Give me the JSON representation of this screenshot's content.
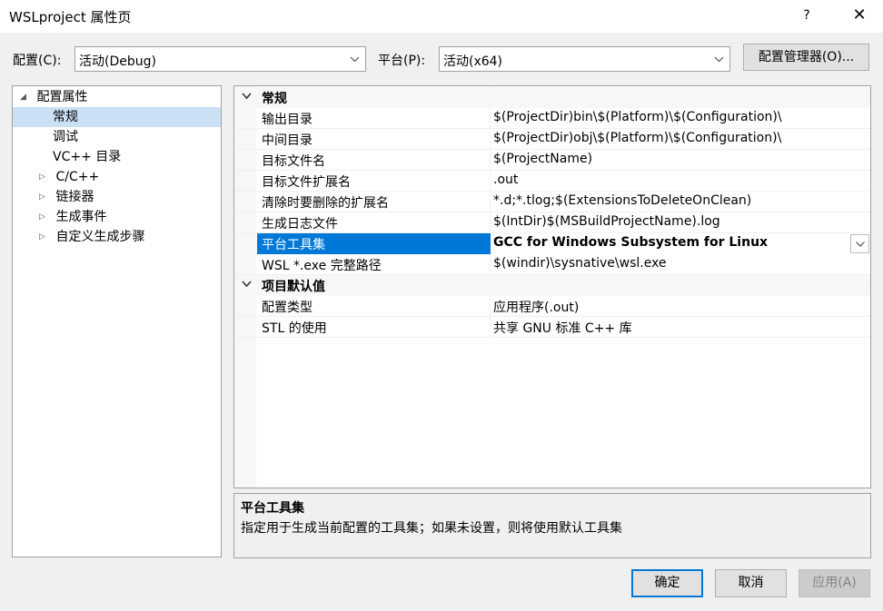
{
  "window": {
    "title": "WSLproject 属性页",
    "help_label": "?",
    "close_label": "✕"
  },
  "toolbar": {
    "config_label": "配置(C):",
    "config_value": "活动(Debug)",
    "platform_label": "平台(P):",
    "platform_value": "活动(x64)",
    "config_manager_label": "配置管理器(O)..."
  },
  "tree": {
    "items": [
      {
        "label": "配置属性",
        "expander": "◢"
      },
      {
        "label": "常规",
        "selected": true
      },
      {
        "label": "调试"
      },
      {
        "label": "VC++ 目录"
      },
      {
        "label": "C/C++",
        "expander": "▷"
      },
      {
        "label": "链接器",
        "expander": "▷"
      },
      {
        "label": "生成事件",
        "expander": "▷"
      },
      {
        "label": "自定义生成步骤",
        "expander": "▷"
      }
    ]
  },
  "grid": {
    "categories": [
      {
        "name": "常规"
      },
      {
        "name": "项目默认值"
      }
    ],
    "general_rows": [
      {
        "name": "输出目录",
        "value": "$(ProjectDir)bin\\$(Platform)\\$(Configuration)\\"
      },
      {
        "name": "中间目录",
        "value": "$(ProjectDir)obj\\$(Platform)\\$(Configuration)\\"
      },
      {
        "name": "目标文件名",
        "value": "$(ProjectName)"
      },
      {
        "name": "目标文件扩展名",
        "value": ".out"
      },
      {
        "name": "清除时要删除的扩展名",
        "value": "*.d;*.tlog;$(ExtensionsToDeleteOnClean)"
      },
      {
        "name": "生成日志文件",
        "value": "$(IntDir)$(MSBuildProjectName).log"
      },
      {
        "name": "平台工具集",
        "value": "GCC for Windows Subsystem for Linux"
      },
      {
        "name": "WSL *.exe 完整路径",
        "value": "$(windir)\\sysnative\\wsl.exe"
      }
    ],
    "default_rows": [
      {
        "name": "配置类型",
        "value": "应用程序(.out)"
      },
      {
        "name": "STL 的使用",
        "value": "共享 GNU 标准 C++ 库"
      }
    ]
  },
  "description": {
    "title": "平台工具集",
    "text": "指定用于生成当前配置的工具集；如果未设置，则将使用默认工具集"
  },
  "buttons": {
    "ok": "确定",
    "cancel": "取消",
    "apply": "应用(A)"
  },
  "colors": {
    "selection": "#0078d7",
    "tree_selection": "#cce0f5",
    "window_bg": "#f0f0f0"
  }
}
